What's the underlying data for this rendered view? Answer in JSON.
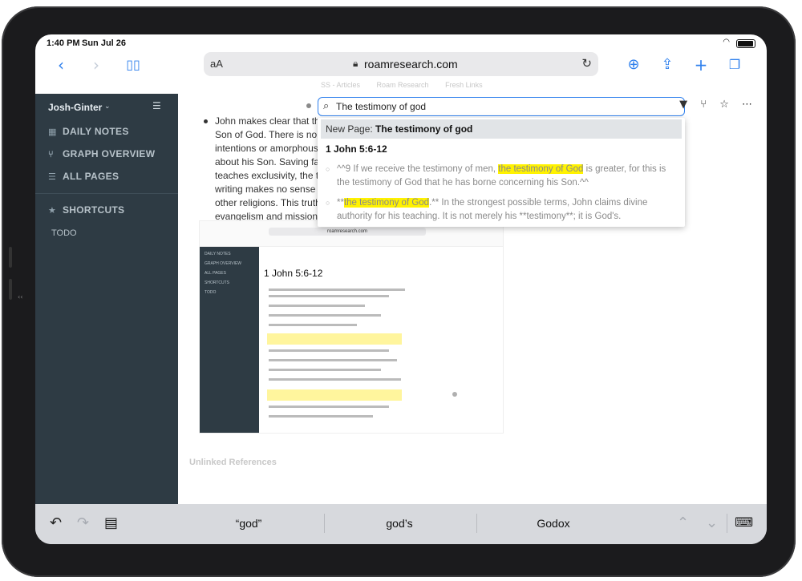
{
  "status": {
    "time": "1:40 PM",
    "date": "Sun Jul 26"
  },
  "browser": {
    "text_size": "aA",
    "url": "roamresearch.com",
    "tabs": [
      "SS - Articles",
      "Roam Research",
      "Fresh Links"
    ]
  },
  "sidebar": {
    "workspace": "Josh-Ginter",
    "items": [
      {
        "label": "DAILY NOTES",
        "icon": "calendar-icon"
      },
      {
        "label": "GRAPH OVERVIEW",
        "icon": "graph-icon"
      },
      {
        "label": "ALL PAGES",
        "icon": "list-icon"
      }
    ],
    "shortcuts_label": "SHORTCUTS",
    "shortcuts": [
      "TODO"
    ]
  },
  "search": {
    "value": "The testimony of god",
    "new_page_prefix": "New Page:",
    "new_page_title": "The testimony of god",
    "ref_title": "1 John 5:6-12",
    "results": [
      {
        "before": "^^9 If we receive the testimony of men, ",
        "highlight": "the testimony of God",
        "after": " is greater, for this is the testimony of God that he has borne concerning his Son.^^"
      },
      {
        "before": "**",
        "highlight": "the testimony of God",
        "after": ".** In the strongest possible terms, John claims divine authority for his teaching. It is not merely his **testimony**; it is God's."
      }
    ]
  },
  "main": {
    "body_text": "John makes clear that the Son of God. There is no e intentions or amorphous f about his Son. Saving fait teaches exclusivity, the tr writing makes no sense if, other religions. This truth evangelism and missions.",
    "embed": {
      "url": "roamresearch.com",
      "page_title": "1 John 5:6-12",
      "sidebar_items": [
        "DAILY NOTES",
        "GRAPH OVERVIEW",
        "ALL PAGES",
        "SHORTCUTS",
        "TODO"
      ]
    },
    "unlinked_refs": "Unlinked References"
  },
  "keyboard": {
    "suggestions": [
      "“god”",
      "god’s",
      "Godox"
    ]
  }
}
